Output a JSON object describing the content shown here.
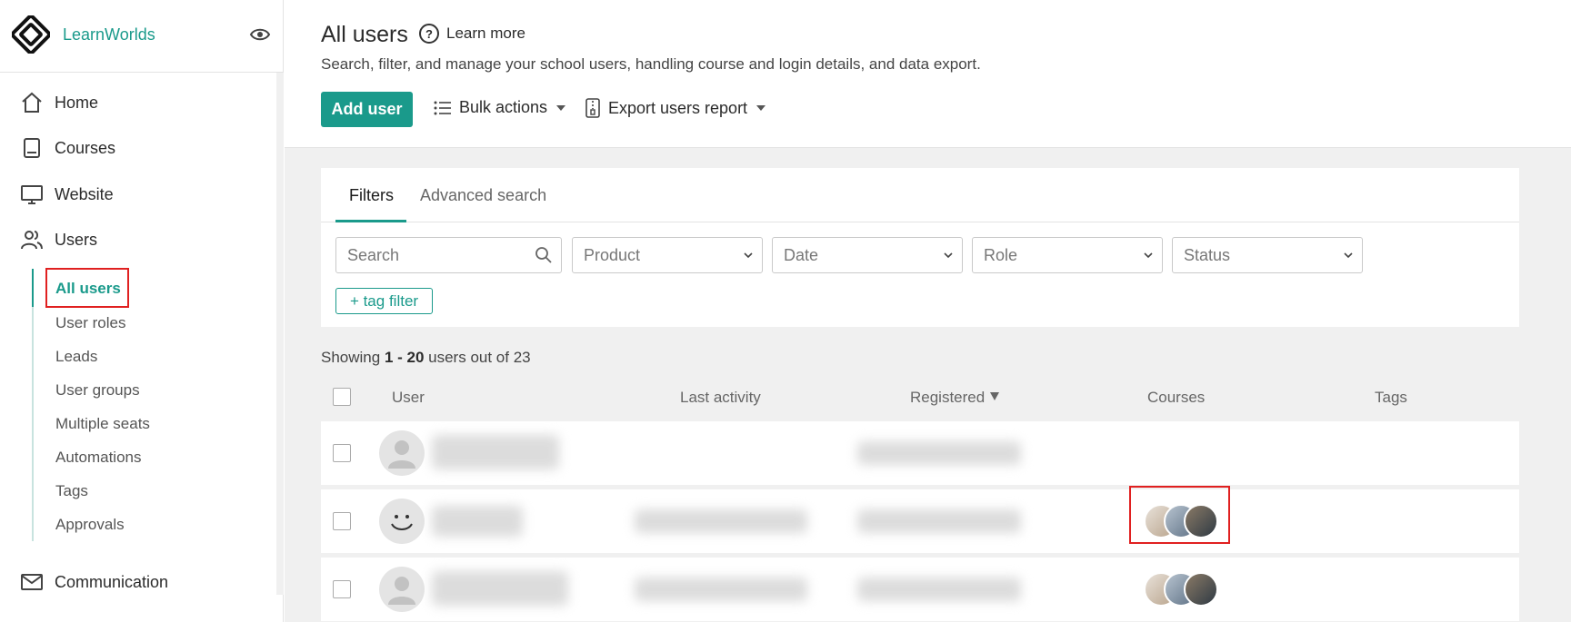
{
  "brand": {
    "name": "LearnWorlds"
  },
  "sidebar": {
    "items": [
      {
        "label": "Home",
        "icon": "home-icon"
      },
      {
        "label": "Courses",
        "icon": "book-icon"
      },
      {
        "label": "Website",
        "icon": "monitor-icon"
      },
      {
        "label": "Users",
        "icon": "users-icon"
      }
    ],
    "sub_items": [
      "All users",
      "User roles",
      "Leads",
      "User groups",
      "Multiple seats",
      "Automations",
      "Tags",
      "Approvals"
    ],
    "active_sub": "All users",
    "bottom_item": {
      "label": "Communication",
      "icon": "mail-icon"
    }
  },
  "header": {
    "title": "All users",
    "learn_more": "Learn more",
    "subtitle": "Search, filter, and manage your school users, handling course and login details, and data export.",
    "add_user": "Add user",
    "bulk_actions": "Bulk actions",
    "export_report": "Export users report"
  },
  "filters": {
    "tabs": [
      "Filters",
      "Advanced search"
    ],
    "active_tab": "Filters",
    "search_placeholder": "Search",
    "selects": [
      "Product",
      "Date",
      "Role",
      "Status"
    ],
    "tag_filter": "+ tag filter"
  },
  "results": {
    "prefix": "Showing ",
    "range": "1 - 20",
    "suffix": " users out of 23"
  },
  "table": {
    "columns": [
      "User",
      "Last activity",
      "Registered",
      "Courses",
      "Tags"
    ],
    "sorted_column": "Registered",
    "rows": [
      {
        "avatar": "default-avatar",
        "courses": 0
      },
      {
        "avatar": "smiley-avatar",
        "courses": 3
      },
      {
        "avatar": "default-avatar",
        "courses": 3
      }
    ]
  },
  "colors": {
    "accent": "#1a9a8b",
    "highlight": "#e02020"
  }
}
